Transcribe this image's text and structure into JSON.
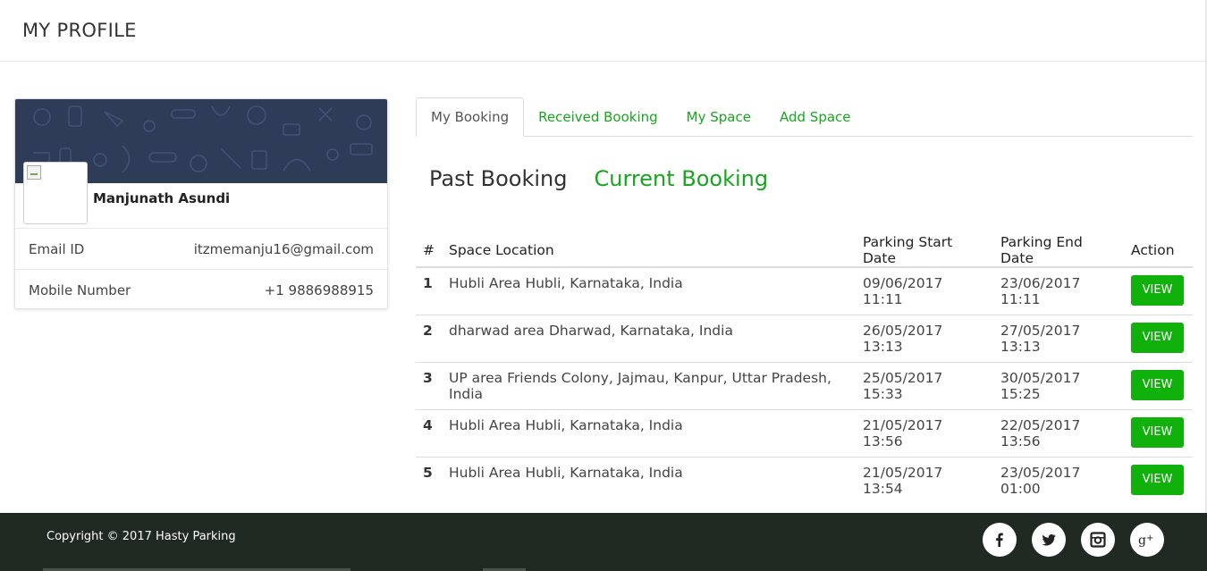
{
  "header": {
    "title": "MY PROFILE"
  },
  "profile": {
    "name": "Manjunath Asundi",
    "email_label": "Email ID",
    "email": "itzmemanju16@gmail.com",
    "mobile_label": "Mobile Number",
    "mobile": "+1 9886988915"
  },
  "tabs": [
    {
      "label": "My Booking",
      "active": true
    },
    {
      "label": "Received Booking",
      "active": false
    },
    {
      "label": "My Space",
      "active": false
    },
    {
      "label": "Add Space",
      "active": false
    }
  ],
  "subtabs": {
    "past": "Past Booking",
    "current": "Current Booking"
  },
  "table": {
    "headers": {
      "num": "#",
      "location": "Space Location",
      "start": "Parking Start Date",
      "end": "Parking End Date",
      "action": "Action"
    },
    "rows": [
      {
        "num": "1",
        "location": "Hubli Area Hubli, Karnataka, India",
        "start": "09/06/2017 11:11",
        "end": "23/06/2017 11:11",
        "action": "VIEW"
      },
      {
        "num": "2",
        "location": "dharwad area Dharwad, Karnataka, India",
        "start": "26/05/2017 13:13",
        "end": "27/05/2017 13:13",
        "action": "VIEW"
      },
      {
        "num": "3",
        "location": "UP area Friends Colony, Jajmau, Kanpur, Uttar Pradesh, India",
        "start": "25/05/2017 15:33",
        "end": "30/05/2017 15:25",
        "action": "VIEW"
      },
      {
        "num": "4",
        "location": "Hubli Area Hubli, Karnataka, India",
        "start": "21/05/2017 13:56",
        "end": "22/05/2017 13:56",
        "action": "VIEW"
      },
      {
        "num": "5",
        "location": "Hubli Area Hubli, Karnataka, India",
        "start": "21/05/2017 13:54",
        "end": "23/05/2017 01:00",
        "action": "VIEW"
      }
    ]
  },
  "footer": {
    "copyright": "Copyright © 2017 Hasty Parking",
    "social": [
      "facebook-icon",
      "twitter-icon",
      "instagram-icon",
      "google-plus-icon"
    ]
  },
  "colors": {
    "accent_green": "#19a51f",
    "button_green": "#10b10b",
    "footer_bg": "#212a22",
    "cover_bg": "#2f3c58"
  }
}
